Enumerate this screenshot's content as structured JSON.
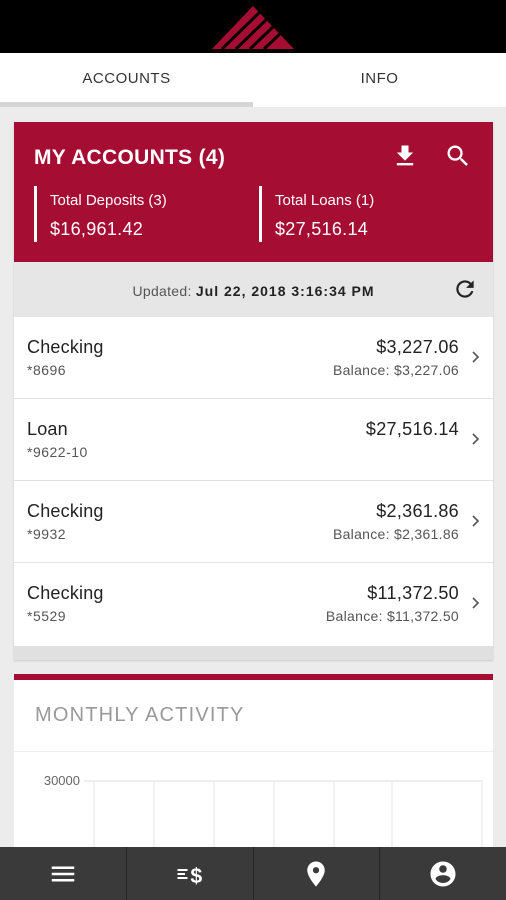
{
  "tabs": [
    {
      "label": "ACCOUNTS"
    },
    {
      "label": "INFO"
    }
  ],
  "accounts_header": {
    "title": "MY ACCOUNTS (4)",
    "total_deposits_label": "Total Deposits (3)",
    "total_deposits_value": "$16,961.42",
    "total_loans_label": "Total Loans (1)",
    "total_loans_value": "$27,516.14",
    "download_icon": "download-icon",
    "search_icon": "search-icon"
  },
  "updated": {
    "label": "Updated:",
    "value": "Jul 22, 2018 3:16:34 PM",
    "refresh_icon": "refresh-icon"
  },
  "accounts": [
    {
      "name": "Checking",
      "number": "*8696",
      "amount": "$3,227.06",
      "balance": "Balance: $3,227.06"
    },
    {
      "name": "Loan",
      "number": "*9622-10",
      "amount": "$27,516.14",
      "balance": ""
    },
    {
      "name": "Checking",
      "number": "*9932",
      "amount": "$2,361.86",
      "balance": "Balance: $2,361.86"
    },
    {
      "name": "Checking",
      "number": "*5529",
      "amount": "$11,372.50",
      "balance": "Balance: $11,372.50"
    }
  ],
  "activity": {
    "title": "MONTHLY ACTIVITY"
  },
  "chart_data": {
    "type": "bar",
    "title": "MONTHLY ACTIVITY",
    "y_tick_labels": [
      "30000"
    ],
    "grid": true
  },
  "bottom_nav": [
    {
      "icon": "menu-icon"
    },
    {
      "icon": "transfer-icon"
    },
    {
      "icon": "location-icon"
    },
    {
      "icon": "profile-icon"
    }
  ],
  "colors": {
    "brand": "#a50d33",
    "topbar": "#000000",
    "bottom_nav": "#3a3a3a"
  }
}
